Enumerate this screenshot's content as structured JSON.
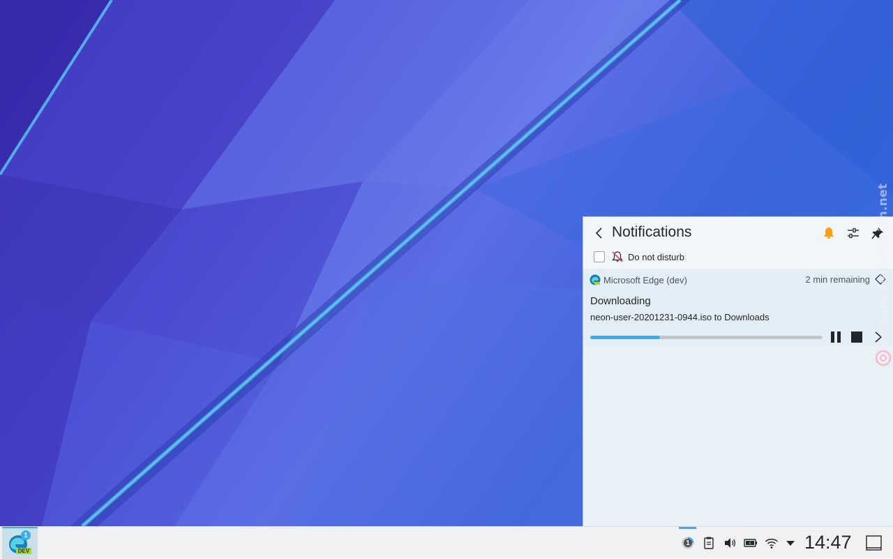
{
  "notifications": {
    "title": "Notifications",
    "do_not_disturb_label": "Do not disturb",
    "do_not_disturb_checked": false,
    "item": {
      "app_name": "Microsoft Edge (dev)",
      "time_remaining": "2 min remaining",
      "title": "Downloading",
      "detail": "neon-user-20201231-0944.iso to Downloads",
      "progress": 0.3
    }
  },
  "taskbar": {
    "tasks": [
      {
        "app": "Microsoft Edge (dev)",
        "badge": "1",
        "tag": "DEV",
        "active": true
      }
    ],
    "tray": {
      "download_job_count": "1",
      "icons": [
        "download-progress-icon",
        "clipboard-icon",
        "volume-icon",
        "battery-icon",
        "wifi-icon",
        "expand-tray-icon"
      ]
    },
    "clock": "14:47"
  },
  "watermark": {
    "text": "screenshots.debian.net"
  },
  "colors": {
    "accent": "#3daee9",
    "bell": "#f6a01a",
    "popup_bg": "#e8f1f7",
    "taskbar_bg": "#eff1f3"
  }
}
